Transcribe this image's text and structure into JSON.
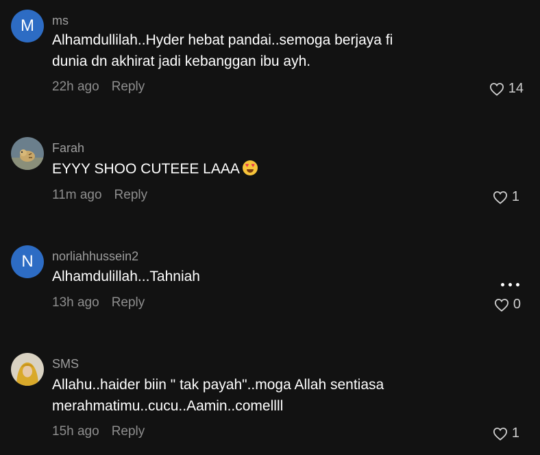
{
  "comments": [
    {
      "avatar_letter": "M",
      "avatar_color": "#2d6cc4",
      "username": "ms",
      "text_line1": "Alhamdullilah..Hyder hebat pandai..semoga berjaya fi",
      "text_line2": "dunia dn akhirat jadi kebanggan ibu ayh.",
      "time": "22h ago",
      "reply_label": "Reply",
      "likes": "14"
    },
    {
      "avatar_icon": "tiger-photo-avatar",
      "username": "Farah",
      "text_line1": "EYYY SHOO CUTEEE LAAA",
      "emoji": "heart-eyes-emoji",
      "time": "11m ago",
      "reply_label": "Reply",
      "likes": "1"
    },
    {
      "avatar_letter": "N",
      "avatar_color": "#2d6cc4",
      "username": "norliahhussein2",
      "text_line1": "Alhamdulillah...Tahniah",
      "time": "13h ago",
      "reply_label": "Reply",
      "likes": "0"
    },
    {
      "avatar_icon": "woman-photo-avatar",
      "username": "SMS",
      "text_line1": "Allahu..haider biin \" tak payah\"..moga Allah sentiasa",
      "text_line2": "merahmatimu..cucu..Aamin..comellll",
      "time": "15h ago",
      "reply_label": "Reply",
      "likes": "1"
    }
  ]
}
